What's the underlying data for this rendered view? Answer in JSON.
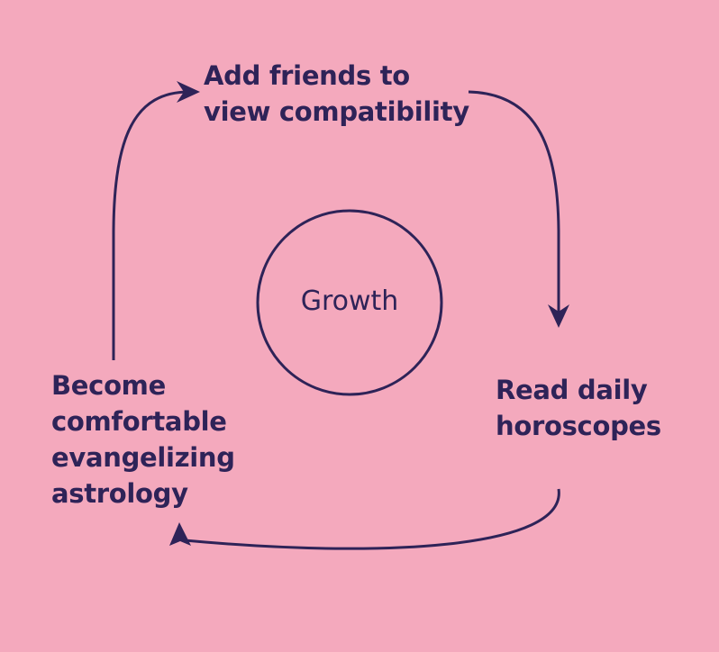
{
  "background_color": "#f4a9bd",
  "ink_color": "#2e2358",
  "center": {
    "label": "Growth"
  },
  "steps": [
    {
      "lines": [
        "Add friends to",
        "view compatibility"
      ]
    },
    {
      "lines": [
        "Read daily",
        "horoscopes"
      ]
    },
    {
      "lines": [
        "Become",
        "comfortable",
        "evangelizing",
        "astrology"
      ]
    }
  ]
}
